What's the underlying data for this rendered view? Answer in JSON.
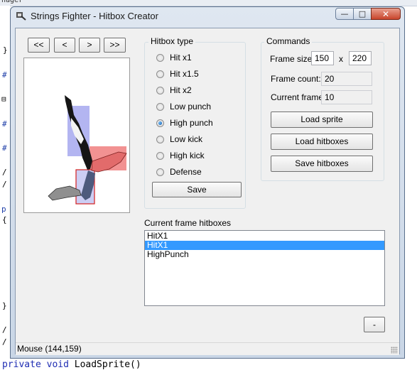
{
  "background": {
    "top_text": "nager",
    "bottom_code_kw": "private void",
    "bottom_code_rest": " LoadSprite()"
  },
  "window": {
    "title": "Strings Fighter - Hitbox Creator",
    "minimize": "—",
    "maximize": "□",
    "close": "✕"
  },
  "nav": {
    "first": "<<",
    "prev": "<",
    "next": ">",
    "last": ">>"
  },
  "hitbox_type": {
    "title": "Hitbox type",
    "options": [
      {
        "label": "Hit x1",
        "checked": false
      },
      {
        "label": "Hit x1.5",
        "checked": false
      },
      {
        "label": "Hit x2",
        "checked": false
      },
      {
        "label": "Low punch",
        "checked": false
      },
      {
        "label": "High punch",
        "checked": true
      },
      {
        "label": "Low kick",
        "checked": false
      },
      {
        "label": "High kick",
        "checked": false
      },
      {
        "label": "Defense",
        "checked": false
      }
    ],
    "save_label": "Save"
  },
  "commands": {
    "title": "Commands",
    "frame_size_label": "Frame size",
    "frame_width": "150",
    "x_label": "x",
    "frame_height": "220",
    "frame_count_label": "Frame count:",
    "frame_count": "20",
    "current_frame_label": "Current frame:",
    "current_frame": "10",
    "load_sprite": "Load sprite",
    "load_hitboxes": "Load hitboxes",
    "save_hitboxes": "Save hitboxes"
  },
  "hitboxes": {
    "title": "Current frame hitboxes",
    "items": [
      "HitX1",
      "HitX1",
      "HighPunch"
    ],
    "selected_index": 1,
    "remove_label": "-"
  },
  "status": {
    "mouse": "Mouse (144,159)"
  },
  "colors": {
    "selection": "#3399ff",
    "hitbox_blue": "#9fa3e8",
    "hitbox_red": "#f08080"
  }
}
